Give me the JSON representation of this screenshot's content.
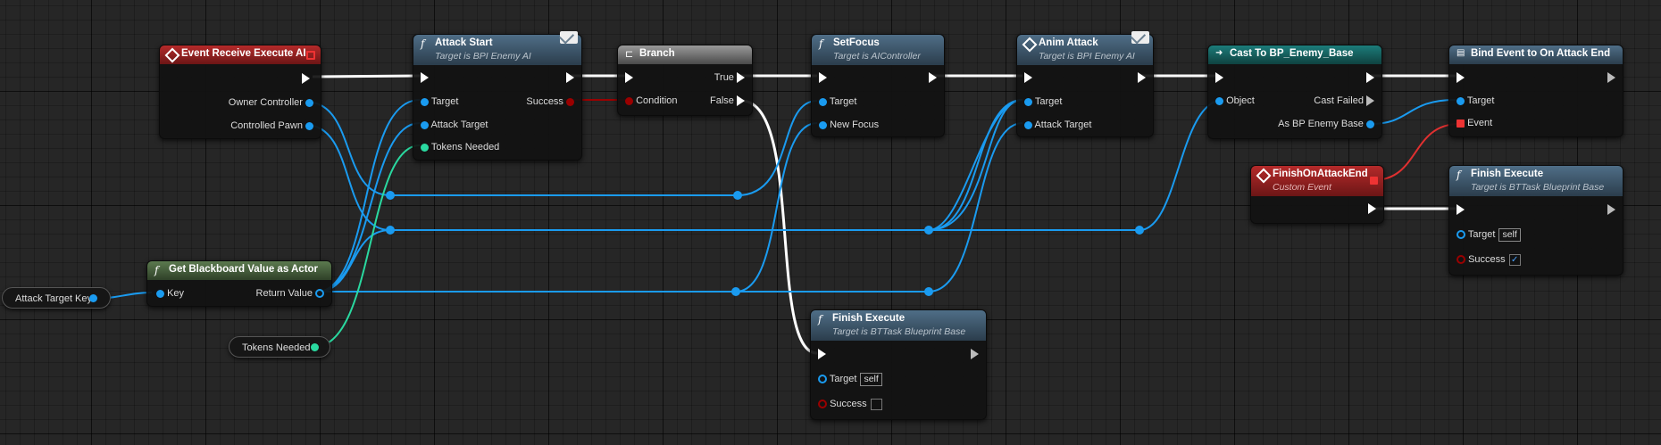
{
  "nodes": {
    "event_receive_execute_ai": {
      "title": "Event Receive Execute AI",
      "pins": {
        "owner_controller": "Owner Controller",
        "controlled_pawn": "Controlled Pawn"
      }
    },
    "attack_start": {
      "title": "Attack Start",
      "subtitle": "Target is BPI Enemy AI",
      "pins": {
        "target": "Target",
        "attack_target": "Attack Target",
        "tokens_needed": "Tokens Needed",
        "success": "Success"
      }
    },
    "branch": {
      "title": "Branch",
      "pins": {
        "condition": "Condition",
        "true": "True",
        "false": "False"
      }
    },
    "set_focus": {
      "title": "SetFocus",
      "subtitle": "Target is AIController",
      "pins": {
        "target": "Target",
        "new_focus": "New Focus"
      }
    },
    "anim_attack": {
      "title": "Anim Attack",
      "subtitle": "Target is BPI Enemy AI",
      "pins": {
        "target": "Target",
        "attack_target": "Attack Target"
      }
    },
    "cast_to": {
      "title": "Cast To BP_Enemy_Base",
      "pins": {
        "object": "Object",
        "cast_failed": "Cast Failed",
        "as_bp_enemy_base": "As BP Enemy Base"
      }
    },
    "bind_event": {
      "title": "Bind Event to On Attack End",
      "pins": {
        "target": "Target",
        "event": "Event"
      }
    },
    "finish_on_attack_end": {
      "title": "FinishOnAttackEnd",
      "subtitle": "Custom Event"
    },
    "finish_execute_top": {
      "title": "Finish Execute",
      "subtitle": "Target is BTTask Blueprint Base",
      "pins": {
        "target": "Target",
        "target_value": "self",
        "success": "Success"
      },
      "success_checked": true
    },
    "finish_execute_bottom": {
      "title": "Finish Execute",
      "subtitle": "Target is BTTask Blueprint Base",
      "pins": {
        "target": "Target",
        "target_value": "self",
        "success": "Success"
      },
      "success_checked": false
    },
    "get_blackboard_value": {
      "title": "Get Blackboard Value as Actor",
      "pins": {
        "key": "Key",
        "return_value": "Return Value"
      }
    }
  },
  "variables": {
    "attack_target_key": "Attack Target Key",
    "tokens_needed": "Tokens Needed"
  },
  "colors": {
    "object_pin": "#1a9bf0",
    "integer_pin": "#2ad9a0",
    "bool_pin": "#9a0000",
    "delegate_pin": "#e03030",
    "exec_wire": "#ffffff",
    "event_header": "#b52a2a",
    "function_header": "#4f6e87",
    "pure_header": "#5b7a4f",
    "cast_header": "#1c7c7a"
  }
}
